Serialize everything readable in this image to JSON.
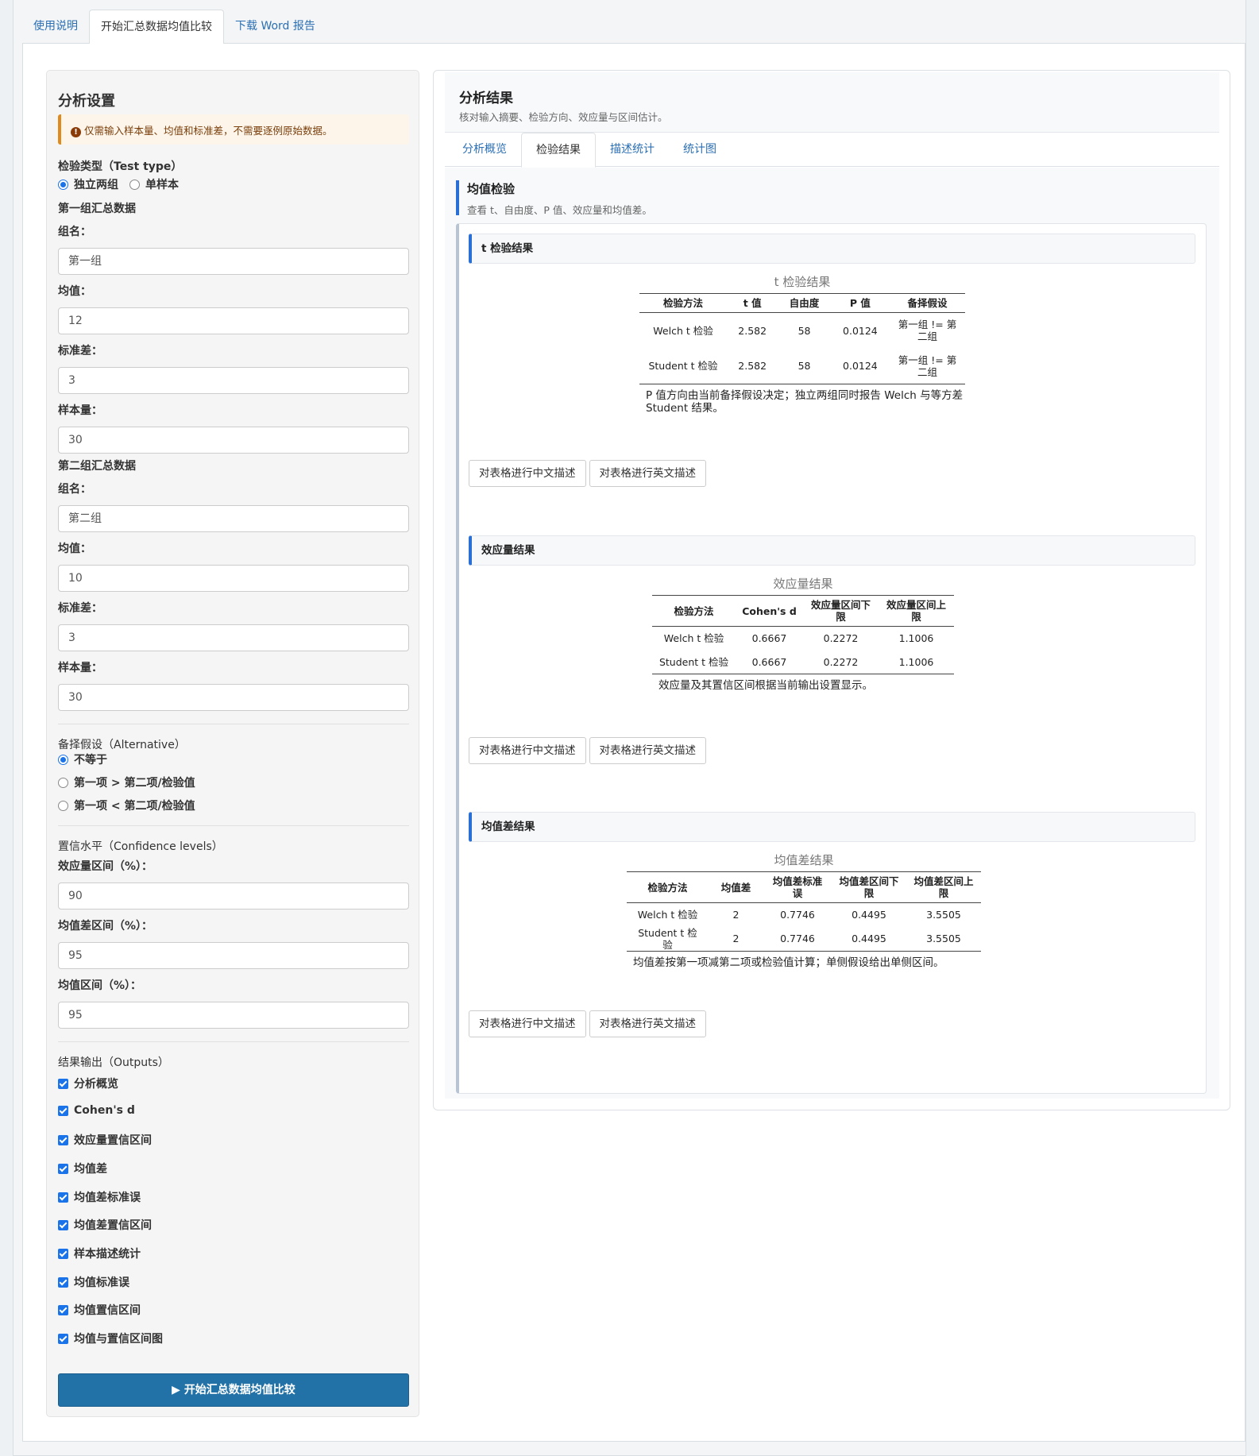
{
  "top_tabs": [
    "使用说明",
    "开始汇总数据均值比较",
    "下载 Word 报告"
  ],
  "sidebar": {
    "title": "分析设置",
    "warning": "仅需输入样本量、均值和标准差，不需要逐例原始数据。",
    "test_type": {
      "label": "检验类型（Test type）",
      "options": [
        "独立两组",
        "单样本"
      ],
      "selected": "独立两组"
    },
    "group1": {
      "heading": "第一组汇总数据",
      "name_label": "组名：",
      "name": "第一组",
      "mean_label": "均值：",
      "mean": "12",
      "sd_label": "标准差：",
      "sd": "3",
      "n_label": "样本量：",
      "n": "30"
    },
    "group2": {
      "heading": "第二组汇总数据",
      "name_label": "组名：",
      "name": "第二组",
      "mean_label": "均值：",
      "mean": "10",
      "sd_label": "标准差：",
      "sd": "3",
      "n_label": "样本量：",
      "n": "30"
    },
    "alternative": {
      "label": "备择假设（Alternative）",
      "options": [
        "不等于",
        "第一项 > 第二项/检验值",
        "第一项 < 第二项/检验值"
      ],
      "selected": "不等于"
    },
    "confidence": {
      "label": "置信水平（Confidence levels）",
      "es_label": "效应量区间（%）：",
      "es": "90",
      "md_label": "均值差区间（%）：",
      "md": "95",
      "mean_label": "均值区间（%）：",
      "mean": "95"
    },
    "outputs": {
      "label": "结果输出（Outputs）",
      "items": [
        "分析概览",
        "Cohen's d",
        "效应量置信区间",
        "均值差",
        "均值差标准误",
        "均值差置信区间",
        "样本描述统计",
        "均值标准误",
        "均值置信区间",
        "均值与置信区间图"
      ]
    },
    "run_button": "▶ 开始汇总数据均值比较"
  },
  "results": {
    "title": "分析结果",
    "subtitle": "核对输入摘要、检验方向、效应量与区间估计。",
    "tabs": [
      "分析概览",
      "检验结果",
      "描述统计",
      "统计图"
    ],
    "active_tab": "检验结果",
    "section_title": "均值检验",
    "section_sub": "查看 t、自由度、P 值、效应量和均值差。",
    "cn_button": "对表格进行中文描述",
    "en_button": "对表格进行英文描述",
    "ttest": {
      "heading": "t 检验结果",
      "caption": "t 检验结果",
      "headers": [
        "检验方法",
        "t 值",
        "自由度",
        "P 值",
        "备择假设"
      ],
      "rows": [
        [
          "Welch t 检验",
          "2.582",
          "58",
          "0.0124",
          "第一组 != 第二组"
        ],
        [
          "Student t 检验",
          "2.582",
          "58",
          "0.0124",
          "第一组 != 第二组"
        ]
      ],
      "note": "P 值方向由当前备择假设决定；独立两组同时报告 Welch 与等方差 Student 结果。"
    },
    "effect": {
      "heading": "效应量结果",
      "caption": "效应量结果",
      "headers": [
        "检验方法",
        "Cohen's d",
        "效应量区间下限",
        "效应量区间上限"
      ],
      "rows": [
        [
          "Welch t 检验",
          "0.6667",
          "0.2272",
          "1.1006"
        ],
        [
          "Student t 检验",
          "0.6667",
          "0.2272",
          "1.1006"
        ]
      ],
      "note": "效应量及其置信区间根据当前输出设置显示。"
    },
    "meandiff": {
      "heading": "均值差结果",
      "caption": "均值差结果",
      "headers": [
        "检验方法",
        "均值差",
        "均值差标准误",
        "均值差区间下限",
        "均值差区间上限"
      ],
      "rows": [
        [
          "Welch t 检验",
          "2",
          "0.7746",
          "0.4495",
          "3.5505"
        ],
        [
          "Student t 检验",
          "2",
          "0.7746",
          "0.4495",
          "3.5505"
        ]
      ],
      "note": "均值差按第一项减第二项或检验值计算；单侧假设给出单侧区间。"
    }
  }
}
